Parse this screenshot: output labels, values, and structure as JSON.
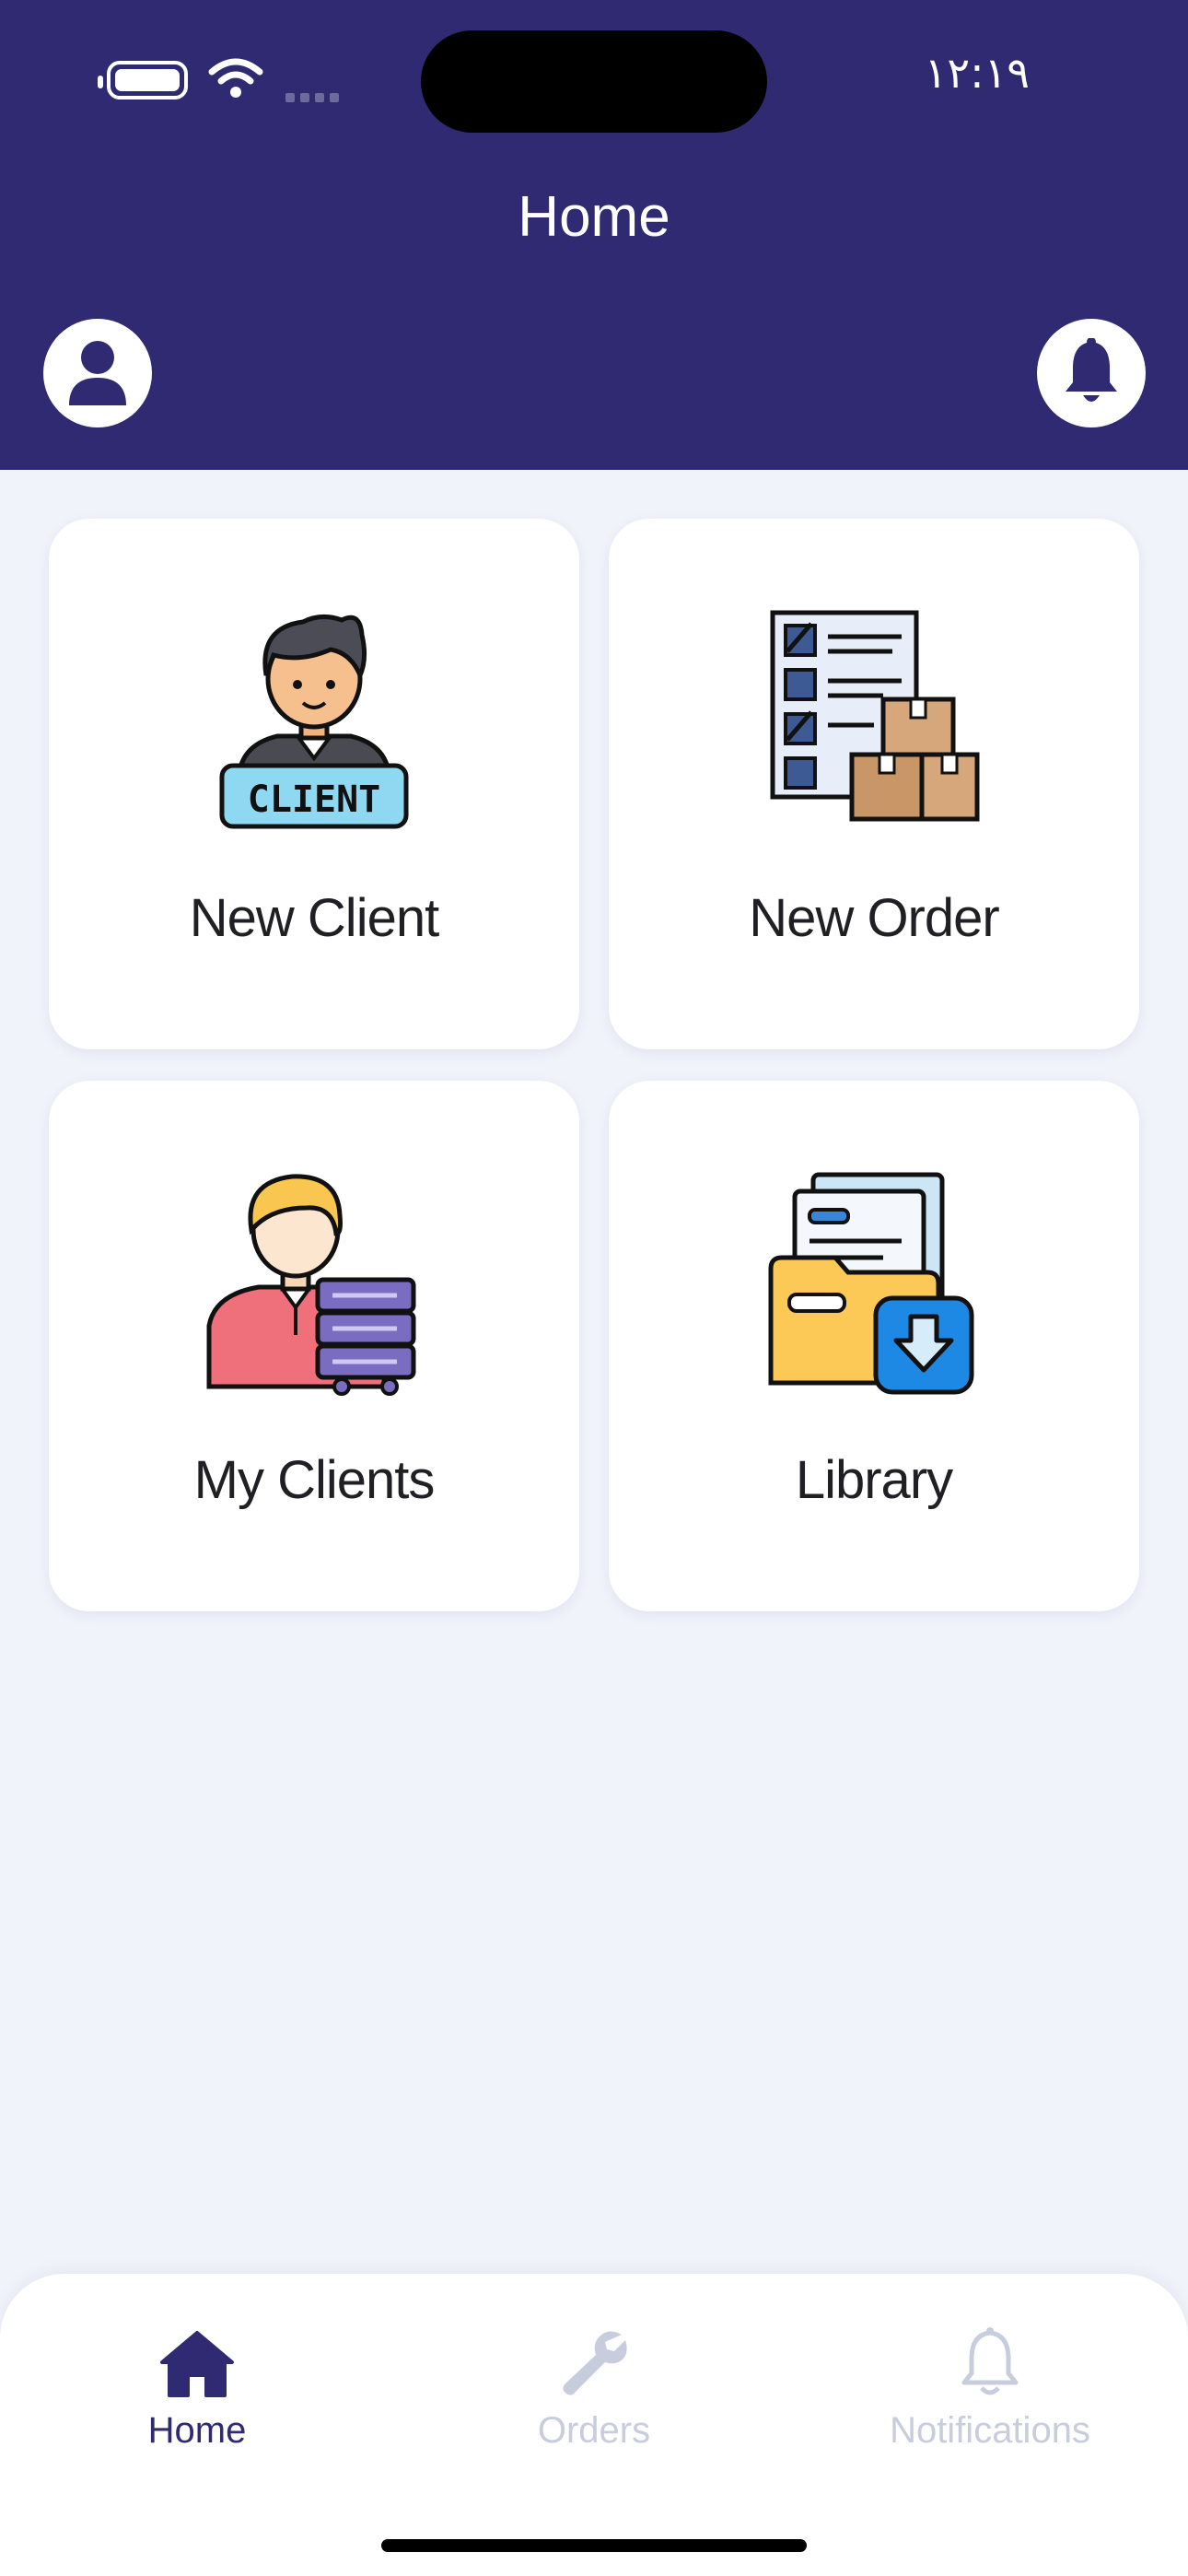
{
  "status_bar": {
    "time": "١٢:١٩"
  },
  "header": {
    "title": "Home"
  },
  "cards": [
    {
      "label": "New Client",
      "badge_text": "CLIENT",
      "icon": "new-client-icon"
    },
    {
      "label": "New Order",
      "icon": "new-order-icon"
    },
    {
      "label": "My Clients",
      "icon": "my-clients-icon"
    },
    {
      "label": "Library",
      "icon": "library-icon"
    }
  ],
  "tabbar": {
    "items": [
      {
        "label": "Home",
        "icon": "home-icon",
        "active": true
      },
      {
        "label": "Orders",
        "icon": "wrench-icon",
        "active": false
      },
      {
        "label": "Notifications",
        "icon": "bell-icon",
        "active": false
      }
    ]
  },
  "colors": {
    "brand": "#302a73",
    "background": "#f1f3fb",
    "inactive": "#c7cddd"
  }
}
